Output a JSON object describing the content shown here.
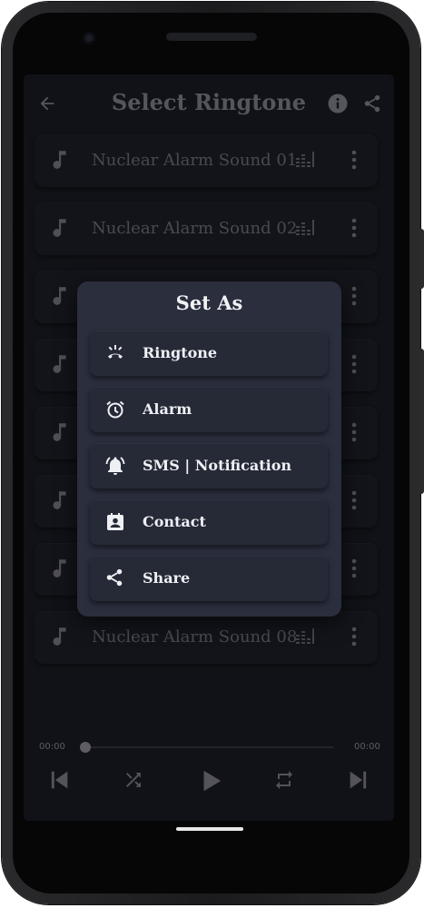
{
  "header": {
    "title": "Select Ringtone",
    "back_icon": "arrow-left-icon",
    "info_icon": "info-icon",
    "share_icon": "share-icon"
  },
  "list": {
    "items": [
      {
        "name": "Nuclear Alarm Sound 01"
      },
      {
        "name": "Nuclear Alarm Sound 02"
      },
      {
        "name": ""
      },
      {
        "name": ""
      },
      {
        "name": ""
      },
      {
        "name": ""
      },
      {
        "name": ""
      },
      {
        "name": "Nuclear Alarm Sound 08"
      }
    ]
  },
  "dialog": {
    "title": "Set As",
    "options": [
      {
        "label": "Ringtone",
        "icon": "ringtone-icon"
      },
      {
        "label": "Alarm",
        "icon": "alarm-clock-icon"
      },
      {
        "label": "SMS | Notification",
        "icon": "notification-bell-icon"
      },
      {
        "label": "Contact",
        "icon": "contact-icon"
      },
      {
        "label": "Share",
        "icon": "share-icon"
      }
    ]
  },
  "player": {
    "current_time": "00:00",
    "total_time": "00:00",
    "progress": 0
  },
  "colors": {
    "screen_bg": "#181a22",
    "dialog_bg": "#2a2e3d",
    "option_bg": "#262a37",
    "text_light": "#eef0f4",
    "text_dim": "#797a84"
  }
}
